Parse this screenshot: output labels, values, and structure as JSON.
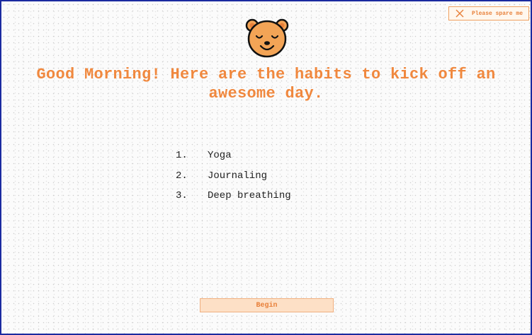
{
  "dismiss_button": {
    "label": "Please spare me",
    "icon": "close-icon"
  },
  "mascot": {
    "icon": "bear-face-icon",
    "color": "#f3a456"
  },
  "headline": "Good Morning! Here are the habits to kick off an awesome day.",
  "habits": [
    {
      "number": "1.",
      "name": "Yoga"
    },
    {
      "number": "2.",
      "name": "Journaling"
    },
    {
      "number": "3.",
      "name": "Deep breathing"
    }
  ],
  "begin_button": {
    "label": "Begin"
  },
  "colors": {
    "accent": "#f0883e",
    "button_fill": "#fde0c6",
    "frame_border": "#1a2aa0"
  }
}
